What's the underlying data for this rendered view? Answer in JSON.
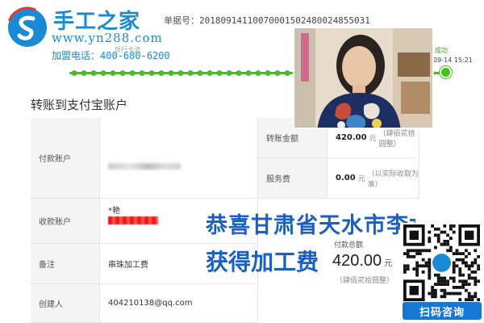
{
  "header": {
    "brand_title": "手工之家",
    "brand_url": "www.yn288.com",
    "phone_label": "加盟电话：",
    "phone_number": "400-680-6200",
    "order_label": "单据号：",
    "order_number": "20180914110070001502480024855031",
    "faint_text": "银行卡流"
  },
  "progress": {
    "status": "成功",
    "time": "09-14 15:21",
    "level": 1.0,
    "color": "#44c01f"
  },
  "section_title": "转账到支付宝账户",
  "table": {
    "payer_label": "付款账户",
    "payee_label": "收款账户",
    "payee_name": "*艳",
    "remark_label": "备注",
    "remark_value": "串珠加工费",
    "creator_label": "创建人",
    "creator_value": "404210138@qq.com",
    "amount_label": "转账金额",
    "amount_value": "420.00",
    "amount_unit": "元",
    "amount_note": "（肆佰贰拾圆整）",
    "fee_label": "服务费",
    "fee_value": "0.00",
    "fee_unit": "元",
    "fee_note": "（以实际收取为准）"
  },
  "total": {
    "label": "付款总额",
    "value": "420.00",
    "unit": "元",
    "note": "（肆佰贰拾圆整）"
  },
  "congrats": {
    "line1": "恭喜甘肃省天水市李女士",
    "line2": "获得加工费"
  },
  "qr_label": "扫码咨询",
  "colors": {
    "brand_blue": "#1a8ad4",
    "progress_green": "#44c01f",
    "congrats_blue": "#1b5fc0",
    "badge_blue": "#1677d4"
  },
  "icons": [
    "logo-icon",
    "qr-code-icon"
  ]
}
